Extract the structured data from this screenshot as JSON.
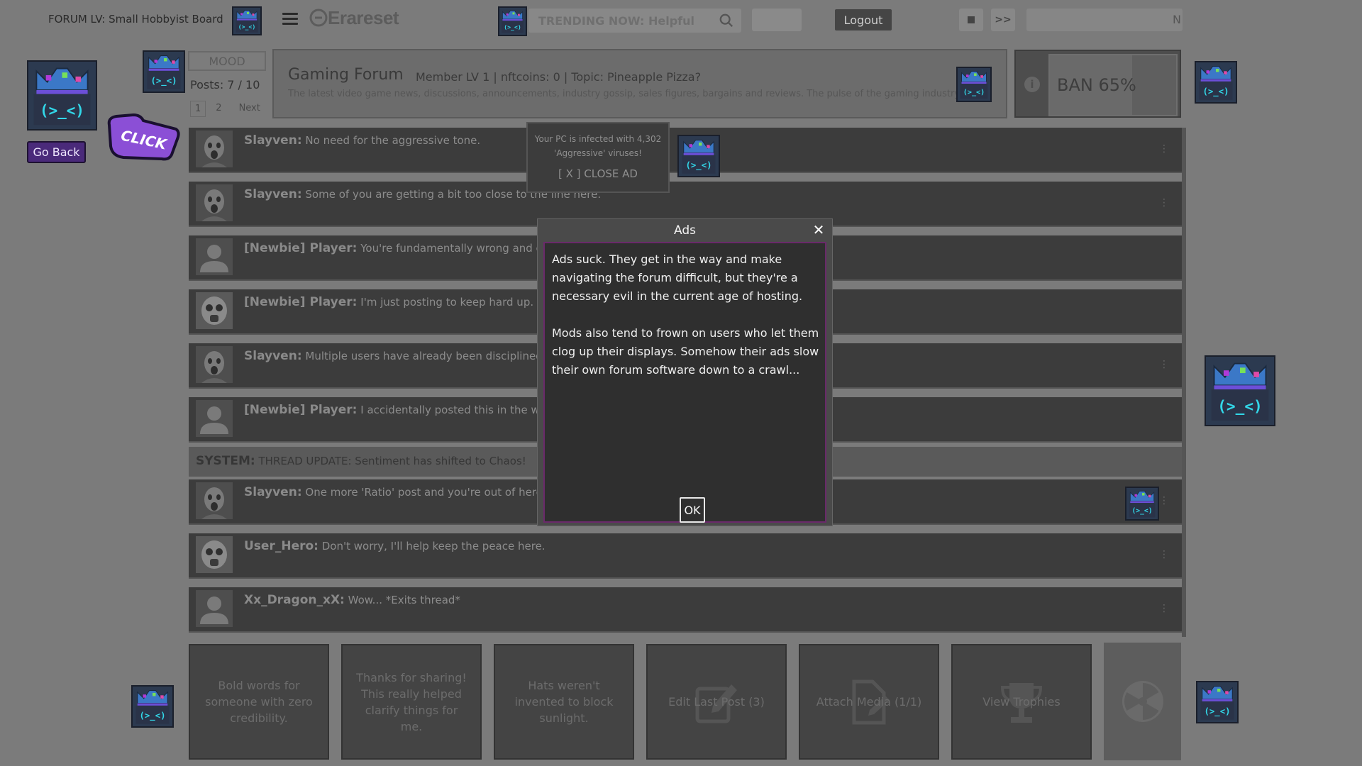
{
  "topbar": {
    "forum_title": "FORUM LV: Small Hobbyist Board",
    "brand": "Erareset",
    "search_placeholder": "TRENDING NOW: Helpful",
    "logout_label": "Logout",
    "ff_label": ">>",
    "right_input_value": "N"
  },
  "left": {
    "go_back_label": "Go Back",
    "click_sticker": "CLICK",
    "mood_label": "MOOD",
    "posts_count": "Posts: 7 / 10",
    "pages": [
      "1",
      "2"
    ],
    "next_label": "Next"
  },
  "header": {
    "title": "Gaming Forum",
    "meta": "Member LV 1 | nftcoins: 0 | Topic: Pineapple Pizza?",
    "description": "The latest video game news, discussions, announcements, industry gossip, sales figures, bargains and reviews. The pulse of the gaming industry."
  },
  "ban": {
    "label": "BAN 65%",
    "percent": 65
  },
  "posts": [
    {
      "user": "Slayven:",
      "text": "No need for the aggressive tone."
    },
    {
      "user": "Slayven:",
      "text": "Some of you are getting a bit too close to the line here."
    },
    {
      "user": "[Newbie] Player:",
      "text": "You're fundamentally wrong and clearly don't understand."
    },
    {
      "user": "[Newbie] Player:",
      "text": "I'm just posting to keep hard up."
    },
    {
      "user": "Slayven:",
      "text": "Multiple users have already been disciplined. Don't test us."
    },
    {
      "user": "[Newbie] Player:",
      "text": "I accidentally posted this in the wrong section."
    },
    {
      "user": "Slayven:",
      "text": "One more 'Ratio' post and you're out of here."
    },
    {
      "user": "User_Hero:",
      "text": "Don't worry, I'll help keep the peace here."
    },
    {
      "user": "Xx_Dragon_xX:",
      "text": "Wow... *Exits thread*"
    }
  ],
  "system": {
    "label": "SYSTEM:",
    "text": "THREAD UPDATE: Sentiment has shifted to Chaos!"
  },
  "ad_popup": {
    "message": "Your PC is infected with 4,302 'Aggressive' viruses!",
    "close_label": "[ X ] CLOSE AD"
  },
  "modal": {
    "title": "Ads",
    "close_glyph": "✕",
    "paragraph1": "Ads suck. They get in the way and make navigating the forum difficult, but they're a necessary evil in the current age of hosting.",
    "paragraph2": "Mods also tend to frown on users who let them clog up their displays. Somehow their ads slow their own forum software down to a crawl...",
    "ok_label": "OK"
  },
  "actions": [
    {
      "label": "Bold words for someone with zero credibility."
    },
    {
      "label": "Thanks for sharing! This really helped clarify things for me."
    },
    {
      "label": "Hats weren't invented to block sunlight."
    },
    {
      "label": "Edit Last Post (3)",
      "icon": "edit-icon"
    },
    {
      "label": "Attach Media (1/1)",
      "icon": "attach-file-icon"
    },
    {
      "label": "View Trophies",
      "icon": "trophy-icon"
    }
  ],
  "colors": {
    "accent_purple": "#4a2a7a",
    "modal_border": "#6a2a6a",
    "mascot_teal": "#32d7e8"
  }
}
